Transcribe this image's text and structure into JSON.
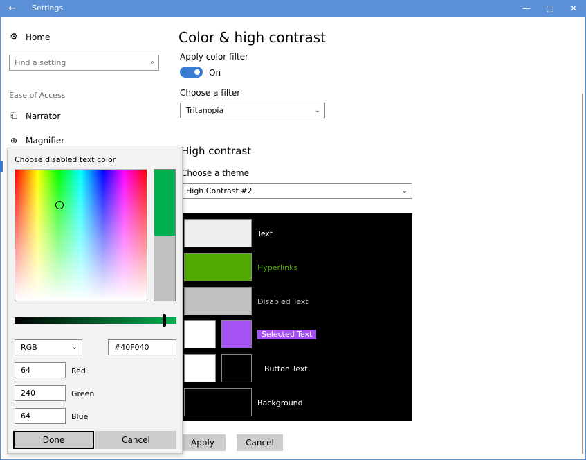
{
  "window": {
    "title": "Settings",
    "back_icon": "←",
    "minimize_icon": "—",
    "maximize_icon": "□",
    "close_icon": "✕"
  },
  "nav": {
    "home_icon": "⚙",
    "home_label": "Home",
    "search_placeholder": "Find a setting",
    "search_icon": "⌕",
    "section_label": "Ease of Access",
    "items": [
      {
        "icon": "⎗",
        "label": "Narrator"
      },
      {
        "icon": "⊕",
        "label": "Magnifier"
      }
    ]
  },
  "main": {
    "page_title": "Color & high contrast",
    "apply_filter_label": "Apply color filter",
    "toggle_state": "On",
    "choose_filter_label": "Choose a filter",
    "filter_value": "Tritanopia",
    "high_contrast_title": "High contrast",
    "choose_theme_label": "Choose a theme",
    "theme_value": "High Contrast #2",
    "chevron": "⌄",
    "preview": {
      "text_label": "Text",
      "hyperlinks_label": "Hyperlinks",
      "disabled_label": "Disabled Text",
      "selected_label": "Selected Text",
      "button_label": "Button Text",
      "background_label": "Background"
    },
    "apply_button": "Apply",
    "cancel_button": "Cancel"
  },
  "picker": {
    "title": "Choose disabled text color",
    "mode": "RGB",
    "hex": "#40F040",
    "red_value": "64",
    "red_label": "Red",
    "green_value": "240",
    "green_label": "Green",
    "blue_value": "64",
    "blue_label": "Blue",
    "done_button": "Done",
    "cancel_button": "Cancel"
  },
  "colors": {
    "accent": "#3a7bd5",
    "titlebar": "#5b8fd6",
    "text_swatch": "#eeeeee",
    "hyperlink_swatch": "#50a800",
    "hyperlink_text": "#50a800",
    "disabled_swatch": "#c0c0c0",
    "selected_bg": "#a552f2",
    "current_color": "#00b050",
    "previous_color": "#c0c0c0"
  }
}
